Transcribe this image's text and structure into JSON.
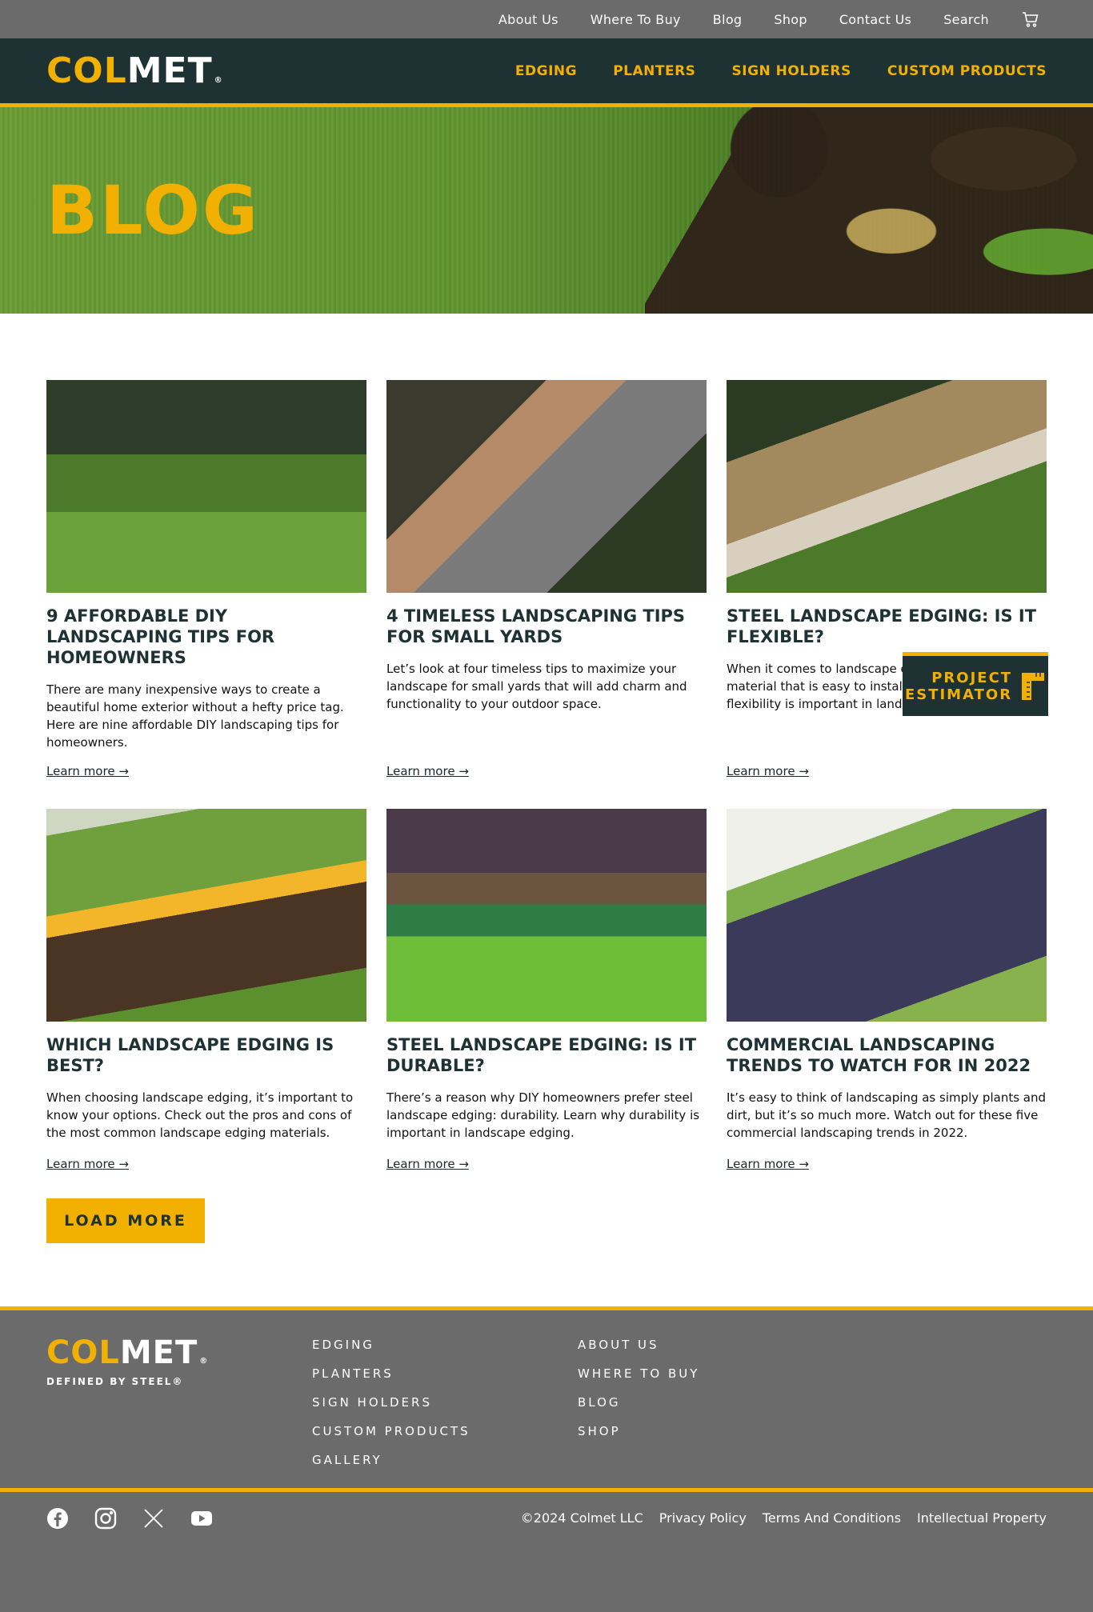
{
  "utility_nav": {
    "items": [
      "About Us",
      "Where To Buy",
      "Blog",
      "Shop",
      "Contact Us",
      "Search"
    ]
  },
  "header": {
    "logo_col": "COL",
    "logo_met": "MET",
    "logo_reg": "®",
    "nav": [
      "EDGING",
      "PLANTERS",
      "SIGN HOLDERS",
      "CUSTOM PRODUCTS"
    ]
  },
  "hero": {
    "title": "BLOG"
  },
  "posts": [
    {
      "title": "9 AFFORDABLE DIY LANDSCAPING TIPS FOR HOMEOWNERS",
      "excerpt": "There are many inexpensive ways to create a beautiful home exterior without a hefty price tag. Here are nine affordable DIY landscaping tips for homeowners.",
      "link": "Learn more →"
    },
    {
      "title": "4 TIMELESS LANDSCAPING TIPS FOR SMALL YARDS",
      "excerpt": "Let’s look at four timeless tips to maximize your landscape for small yards that will add charm and functionality to your outdoor space.",
      "link": "Learn more →"
    },
    {
      "title": "STEEL LANDSCAPE EDGING: IS IT FLEXIBLE?",
      "excerpt": "When it comes to landscape edging, choosing a material that is easy to install is key. Learn why flexibility is important in landscape edging.",
      "link": "Learn more →"
    },
    {
      "title": "WHICH LANDSCAPE EDGING IS BEST?",
      "excerpt": "When choosing landscape edging, it’s important to know your options. Check out the pros and cons of the most common landscape edging materials.",
      "link": "Learn more →"
    },
    {
      "title": "STEEL LANDSCAPE EDGING: IS IT DURABLE?",
      "excerpt": "There’s a reason why DIY homeowners prefer steel landscape edging: durability. Learn why durability is important in landscape edging.",
      "link": "Learn more →"
    },
    {
      "title": "COMMERCIAL LANDSCAPING TRENDS TO WATCH FOR IN 2022",
      "excerpt": "It’s easy to think of landscaping as simply plants and dirt, but it’s so much more. Watch out for these five commercial landscaping trends in 2022.",
      "link": "Learn more →"
    }
  ],
  "load_more": "LOAD MORE",
  "estimator": {
    "line1": "PROJECT",
    "line2": "ESTIMATOR"
  },
  "footer": {
    "logo_col": "COL",
    "logo_met": "MET",
    "logo_reg": "®",
    "tagline": "DEFINED BY STEEL®",
    "col1": [
      "EDGING",
      "PLANTERS",
      "SIGN HOLDERS",
      "CUSTOM PRODUCTS",
      "GALLERY"
    ],
    "col2": [
      "ABOUT US",
      "WHERE TO BUY",
      "BLOG",
      "SHOP"
    ],
    "legal": [
      "©2024 Colmet LLC",
      "Privacy Policy",
      "Terms And Conditions",
      "Intellectual Property"
    ],
    "social_icons": [
      "facebook-icon",
      "instagram-icon",
      "x-icon",
      "youtube-icon"
    ]
  },
  "colors": {
    "brand_yellow": "#f2b000",
    "brand_dark": "#1f3233",
    "gray": "#6b6b6b"
  }
}
